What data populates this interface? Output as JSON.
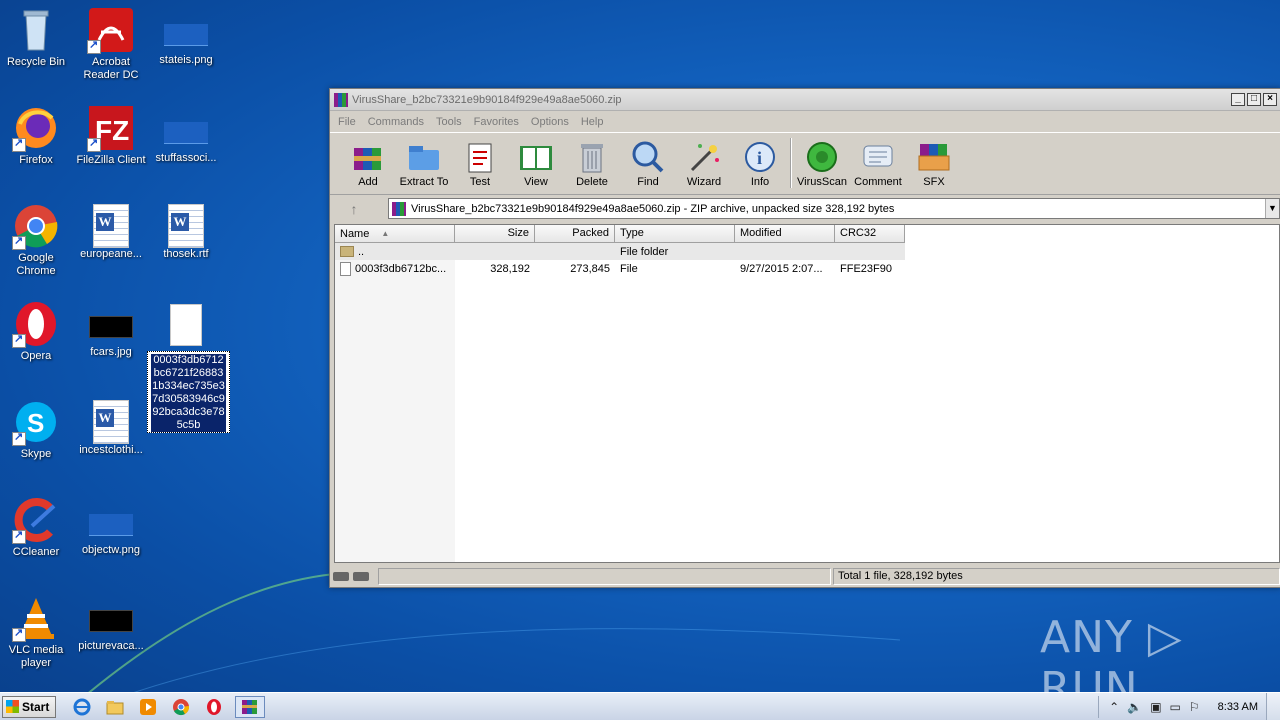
{
  "desktop": {
    "icons": [
      {
        "label": "Recycle Bin",
        "icon": "recycle-bin-icon"
      },
      {
        "label": "Acrobat Reader DC",
        "icon": "acrobat-icon"
      },
      {
        "label": "stateis.png",
        "icon": "image-file-icon"
      },
      {
        "label": "Firefox",
        "icon": "firefox-icon"
      },
      {
        "label": "FileZilla Client",
        "icon": "filezilla-icon"
      },
      {
        "label": "stuffassoci...",
        "icon": "image-file-icon"
      },
      {
        "label": "Google Chrome",
        "icon": "chrome-icon"
      },
      {
        "label": "europeane...",
        "icon": "word-doc-icon"
      },
      {
        "label": "thosek.rtf",
        "icon": "word-doc-icon"
      },
      {
        "label": "Opera",
        "icon": "opera-icon"
      },
      {
        "label": "fcars.jpg",
        "icon": "image-file-icon"
      },
      {
        "label": "Skype",
        "icon": "skype-icon"
      },
      {
        "label": "incestclothi...",
        "icon": "word-doc-icon"
      },
      {
        "label": "CCleaner",
        "icon": "ccleaner-icon"
      },
      {
        "label": "objectw.png",
        "icon": "image-file-icon"
      },
      {
        "label": "VLC media player",
        "icon": "vlc-icon"
      },
      {
        "label": "picturevaca...",
        "icon": "image-file-icon"
      }
    ],
    "selected_file_label_lines": [
      "0003f3db6712",
      "bc6721f26883",
      "1b334ec735e3",
      "7d30583946c9",
      "92bca3dc3e78",
      "5c5b"
    ]
  },
  "window": {
    "title": "VirusShare_b2bc73321e9b90184f929e49a8ae5060.zip",
    "controls": {
      "minimize": "_",
      "maximize": "□",
      "close": "×"
    },
    "menu": [
      "File",
      "Commands",
      "Tools",
      "Favorites",
      "Options",
      "Help"
    ],
    "toolbar": [
      {
        "label": "Add",
        "icon": "add-archive-icon"
      },
      {
        "label": "Extract To",
        "icon": "extract-to-icon"
      },
      {
        "label": "Test",
        "icon": "test-icon"
      },
      {
        "label": "View",
        "icon": "view-book-icon"
      },
      {
        "label": "Delete",
        "icon": "delete-bin-icon"
      },
      {
        "label": "Find",
        "icon": "find-magnifier-icon"
      },
      {
        "label": "Wizard",
        "icon": "wizard-wand-icon"
      },
      {
        "label": "Info",
        "icon": "info-icon"
      },
      {
        "label": "VirusScan",
        "icon": "virusscan-icon"
      },
      {
        "label": "Comment",
        "icon": "comment-icon"
      },
      {
        "label": "SFX",
        "icon": "sfx-icon"
      }
    ],
    "address": "VirusShare_b2bc73321e9b90184f929e49a8ae5060.zip - ZIP archive, unpacked size 328,192 bytes",
    "columns": [
      "Name",
      "Size",
      "Packed",
      "Type",
      "Modified",
      "CRC32"
    ],
    "rows": [
      {
        "name": "..",
        "size": "",
        "packed": "",
        "type": "File folder",
        "modified": "",
        "crc": ""
      },
      {
        "name": "0003f3db6712bc...",
        "size": "328,192",
        "packed": "273,845",
        "type": "File",
        "modified": "9/27/2015 2:07...",
        "crc": "FFE23F90"
      }
    ],
    "status": "Total 1 file, 328,192 bytes"
  },
  "taskbar": {
    "start_label": "Start",
    "clock": "8:33 AM"
  },
  "watermark": "ANY ▷ RUN",
  "colors": {
    "accent": "#1466c4",
    "selection": "#0a246a"
  }
}
